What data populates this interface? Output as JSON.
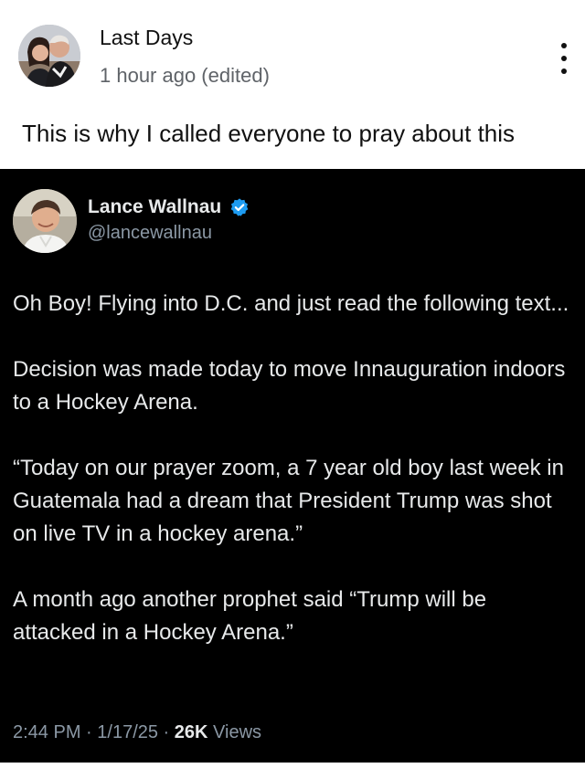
{
  "post": {
    "author_name": "Last Days",
    "time": "1 hour ago (edited)",
    "caption": "This is why I called everyone to pray about this",
    "avatar_icon": "couple-photo-avatar",
    "menu_icon": "more-vertical-icon"
  },
  "tweet": {
    "display_name": "Lance Wallnau",
    "handle": "@lancewallnau",
    "verified_icon": "verified-badge-icon",
    "verified_color": "#1d9bf0",
    "avatar_icon": "man-photo-avatar",
    "paragraphs": [
      "Oh Boy! Flying into D.C. and just read the following text...",
      "Decision was made today to move Innauguration indoors to a Hockey Arena.",
      "“Today on our  prayer zoom, a 7 year old boy last week in Guatemala had a dream that President Trump was shot on live TV in a hockey arena.”",
      "A month ago another prophet said “Trump will be attacked in a Hockey Arena.”"
    ],
    "time": "2:44 PM",
    "separator": " · ",
    "date": "1/17/25",
    "views_count": "26K",
    "views_label": " Views"
  }
}
